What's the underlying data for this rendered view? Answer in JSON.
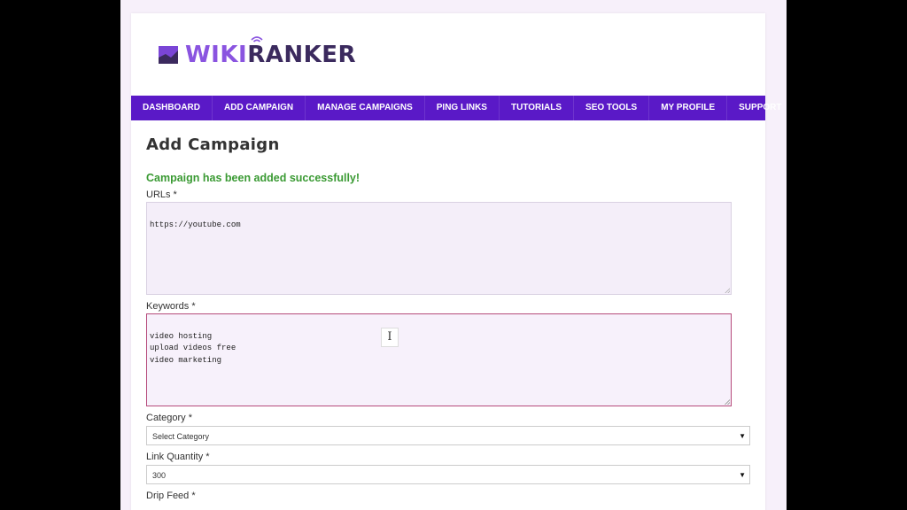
{
  "brand": {
    "wiki": "WIKI",
    "ranker": "RANKER"
  },
  "nav": {
    "items": [
      {
        "label": "DASHBOARD"
      },
      {
        "label": "ADD CAMPAIGN"
      },
      {
        "label": "MANAGE CAMPAIGNS"
      },
      {
        "label": "PING LINKS"
      },
      {
        "label": "TUTORIALS"
      },
      {
        "label": "SEO TOOLS"
      },
      {
        "label": "MY PROFILE"
      },
      {
        "label": "SUPPORT"
      }
    ]
  },
  "page": {
    "title": "Add Campaign",
    "success_message": "Campaign has been added successfully!"
  },
  "form": {
    "urls": {
      "label": "URLs *",
      "value": "https://youtube.com"
    },
    "keywords": {
      "label": "Keywords *",
      "value": "video hosting\nupload videos free\nvideo marketing"
    },
    "category": {
      "label": "Category *",
      "selected": "Select Category"
    },
    "link_quantity": {
      "label": "Link Quantity *",
      "selected": "300"
    },
    "drip_feed": {
      "label": "Drip Feed *"
    }
  },
  "icons": {
    "logo": "chart-logo-icon",
    "logo_signal": "wifi-signal-icon",
    "cursor": "text-cursor-icon",
    "select_arrow": "chevron-down-icon"
  },
  "colors": {
    "nav_bg": "#5a19c7",
    "brand_wiki": "#8a54e0",
    "brand_ranker": "#3b2a5e",
    "success": "#3a9a33",
    "focus_border": "#b54a7a"
  }
}
